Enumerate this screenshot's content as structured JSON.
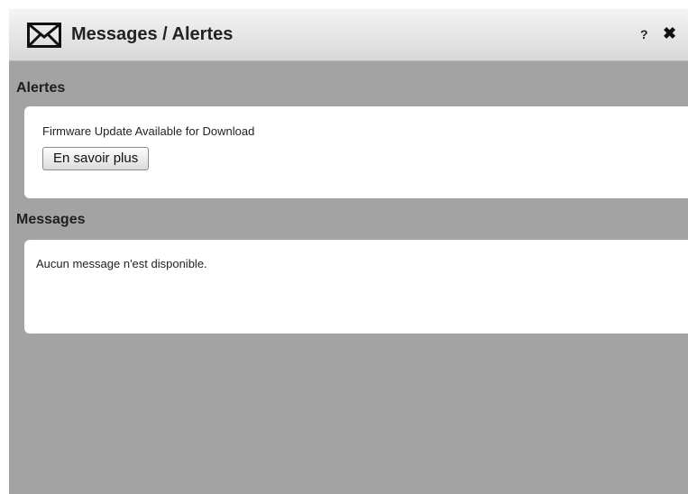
{
  "window": {
    "title": "Messages / Alertes",
    "help_label": "?",
    "close_label": "✖",
    "title_icon": "envelope-icon"
  },
  "alerts": {
    "heading": "Alertes",
    "items": [
      {
        "text": "Firmware Update Available for Download",
        "button_label": "En savoir plus"
      }
    ]
  },
  "messages": {
    "heading": "Messages",
    "empty_text": "Aucun message n'est disponible."
  },
  "colors": {
    "background": "#a3a3a3",
    "panel": "#ffffff",
    "titlebar_top": "#f4f4f4",
    "titlebar_bottom": "#d8d8d8"
  }
}
